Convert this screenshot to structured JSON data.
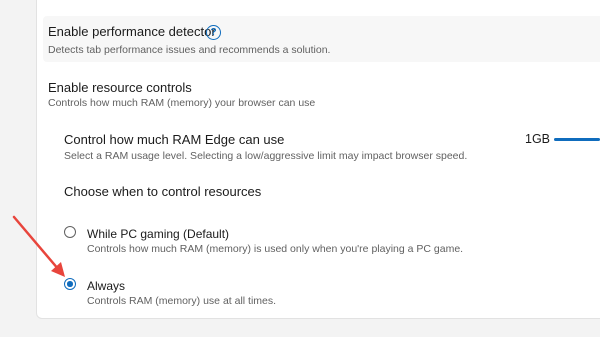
{
  "performance_detector": {
    "title": "Enable performance detector",
    "description": "Detects tab performance issues and recommends a solution."
  },
  "resource_controls": {
    "title": "Enable resource controls",
    "description": "Controls how much RAM (memory) your browser can use"
  },
  "ram_limit": {
    "title": "Control how much RAM Edge can use",
    "description": "Select a RAM usage level. Selecting a low/aggressive limit may impact browser speed.",
    "value_label": "1GB"
  },
  "when_to_control": {
    "heading": "Choose when to control resources",
    "options": [
      {
        "label": "While PC gaming (Default)",
        "description": "Controls how much RAM (memory) is used only when you're playing a PC game.",
        "selected": false
      },
      {
        "label": "Always",
        "description": "Controls RAM (memory) use at all times.",
        "selected": true
      }
    ]
  },
  "colors": {
    "accent": "#0f6cbd",
    "annotation_arrow": "#e8453c"
  }
}
